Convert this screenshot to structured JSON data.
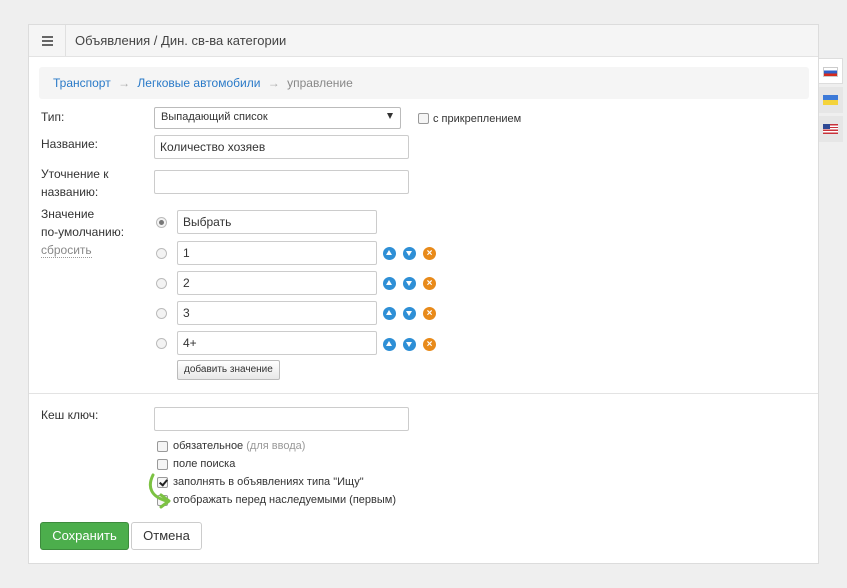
{
  "header": {
    "title": "Объявления / Дин. св-ва категории"
  },
  "breadcrumb": {
    "items": [
      "Транспорт",
      "Легковые автомобили",
      "управление"
    ],
    "separator": "→"
  },
  "form": {
    "type_label": "Тип:",
    "type_value": "Выпадающий список",
    "attach_label": "с прикреплением",
    "name_label": "Название:",
    "name_value": "Количество хозяев",
    "clarify_label_1": "Уточнение к",
    "clarify_label_2": "названию:",
    "clarify_value": "",
    "default_label_1": "Значение",
    "default_label_2": "по-умолчанию:",
    "reset_label": "сбросить",
    "values": [
      "Выбрать",
      "1",
      "2",
      "3",
      "4+"
    ],
    "add_value_label": "добавить значение",
    "cache_key_label": "Кеш ключ:",
    "cache_key_value": "",
    "options": [
      {
        "label": "обязательное",
        "hint": "(для ввода)",
        "checked": false
      },
      {
        "label": "поле поиска",
        "hint": "",
        "checked": false
      },
      {
        "label": "заполнять в объявлениях типа \"Ищу\"",
        "hint": "",
        "checked": true
      },
      {
        "label": "отображать перед наследуемыми (первым)",
        "hint": "",
        "checked": false
      }
    ]
  },
  "actions": {
    "save_label": "Сохранить",
    "cancel_label": "Отмена"
  },
  "languages": [
    "ru",
    "ua",
    "en"
  ],
  "colors": {
    "save": "#4cae4c",
    "link": "#2a7ac8",
    "move_icon": "#2e8fd6",
    "delete_icon": "#e88a1a",
    "hint_arrow": "#7cc242"
  }
}
